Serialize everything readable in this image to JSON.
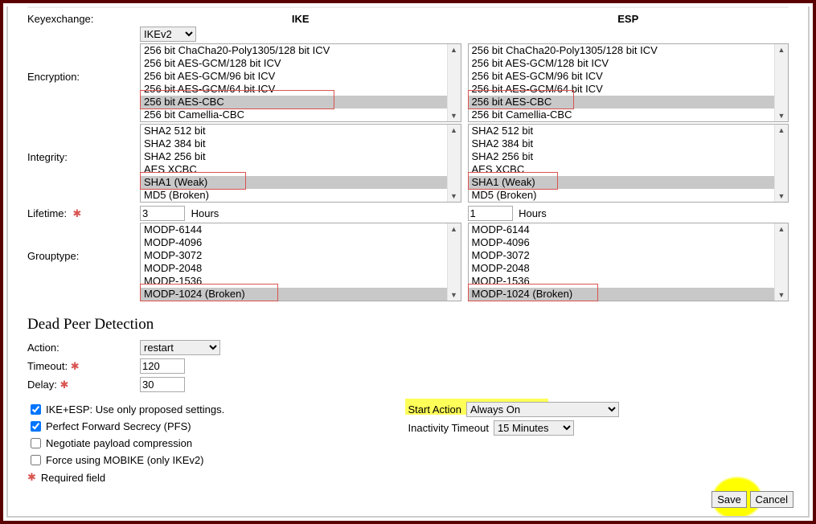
{
  "headers": {
    "ike": "IKE",
    "esp": "ESP"
  },
  "labels": {
    "keyexchange": "Keyexchange:",
    "encryption": "Encryption:",
    "integrity": "Integrity:",
    "lifetime": "Lifetime:",
    "grouptype": "Grouptype:",
    "hours": "Hours",
    "action": "Action:",
    "timeout": "Timeout:",
    "delay": "Delay:",
    "start_action": "Start Action",
    "inactivity_timeout": "Inactivity Timeout",
    "required": "Required field"
  },
  "keyexchange": {
    "value": "IKEv2",
    "options": [
      "IKEv2"
    ]
  },
  "lifetime": {
    "ike": "3",
    "esp": "1"
  },
  "encryption": {
    "items": [
      "256 bit ChaCha20-Poly1305/128 bit ICV",
      "256 bit AES-GCM/128 bit ICV",
      "256 bit AES-GCM/96 bit ICV",
      "256 bit AES-GCM/64 bit ICV",
      "256 bit AES-CBC",
      "256 bit Camellia-CBC"
    ],
    "selected_index": 4
  },
  "integrity": {
    "items": [
      "SHA2 512 bit",
      "SHA2 384 bit",
      "SHA2 256 bit",
      "AES XCBC",
      "SHA1 (Weak)",
      "MD5 (Broken)"
    ],
    "selected_index": 4
  },
  "grouptype": {
    "items": [
      "MODP-6144",
      "MODP-4096",
      "MODP-3072",
      "MODP-2048",
      "MODP-1536",
      "MODP-1024 (Broken)"
    ],
    "selected_index": 5
  },
  "dpd": {
    "heading": "Dead Peer Detection",
    "action_value": "restart",
    "action_options": [
      "restart"
    ],
    "timeout": "120",
    "delay": "30"
  },
  "checks": {
    "ike_esp_only": {
      "label": "IKE+ESP: Use only proposed settings.",
      "checked": true
    },
    "pfs": {
      "label": "Perfect Forward Secrecy (PFS)",
      "checked": true
    },
    "payload_comp": {
      "label": "Negotiate payload compression",
      "checked": false
    },
    "mobike": {
      "label": "Force using MOBIKE (only IKEv2)",
      "checked": false
    }
  },
  "start_action": {
    "value": "Always On",
    "options": [
      "Always On"
    ]
  },
  "inactivity": {
    "value": "15 Minutes",
    "options": [
      "15 Minutes"
    ]
  },
  "buttons": {
    "save": "Save",
    "cancel": "Cancel"
  }
}
